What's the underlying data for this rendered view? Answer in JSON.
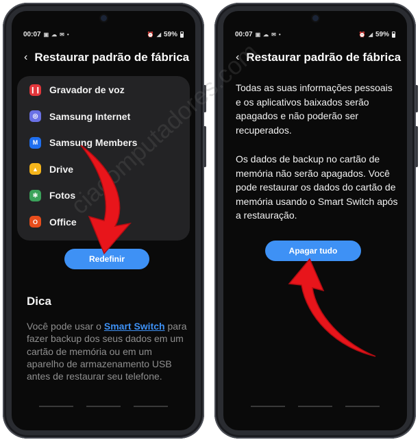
{
  "colors": {
    "accent": "#3e91f5",
    "arrow": "#e8151b",
    "screen_bg": "#0a0a0a",
    "card_bg": "#232325"
  },
  "left_phone": {
    "status": {
      "time": "00:07",
      "battery": "59%",
      "left_icons": [
        "image-icon",
        "cloud-icon",
        "mail-icon",
        "dot-icon"
      ],
      "right_icons": [
        "alarm-icon",
        "signal-icon"
      ]
    },
    "title": "Restaurar padrão de fábrica",
    "apps": [
      {
        "name": "Gravador de voz",
        "icon": "voice-recorder-icon",
        "glyph": "❙❙",
        "color": "#e2363b"
      },
      {
        "name": "Samsung Internet",
        "icon": "samsung-internet-icon",
        "glyph": "◎",
        "color": "#6a71e6"
      },
      {
        "name": "Samsung Members",
        "icon": "samsung-members-icon",
        "glyph": "M",
        "color": "#1f6ff0"
      },
      {
        "name": "Drive",
        "icon": "google-drive-icon",
        "glyph": "▲",
        "color": "#f5b51b"
      },
      {
        "name": "Fotos",
        "icon": "google-photos-icon",
        "glyph": "✻",
        "color": "#3ba35b"
      },
      {
        "name": "Office",
        "icon": "microsoft-office-icon",
        "glyph": "O",
        "color": "#e84d1c"
      }
    ],
    "reset_button": "Redefinir",
    "tip_title": "Dica",
    "tip_before": "Você pode usar o ",
    "tip_link": "Smart Switch",
    "tip_after": " para fazer backup dos seus dados em um cartão de memória ou em um aparelho de armazenamento USB antes de restaurar seu telefone."
  },
  "right_phone": {
    "status": {
      "time": "00:07",
      "battery": "59%",
      "left_icons": [
        "image-icon",
        "cloud-icon",
        "mail-icon",
        "dot-icon"
      ],
      "right_icons": [
        "alarm-icon",
        "signal-icon"
      ]
    },
    "title": "Restaurar padrão de fábrica",
    "desc_p1": "Todas as suas informações pessoais e os aplicativos baixados serão apagados e não poderão ser recuperados.",
    "desc_p2": "Os dados de backup no cartão de memória não serão apagados. Você pode restaurar os dados do cartão de memória usando o Smart Switch após a restauração.",
    "erase_button": "Apagar tudo"
  },
  "watermark": "ciacomputadores.com"
}
